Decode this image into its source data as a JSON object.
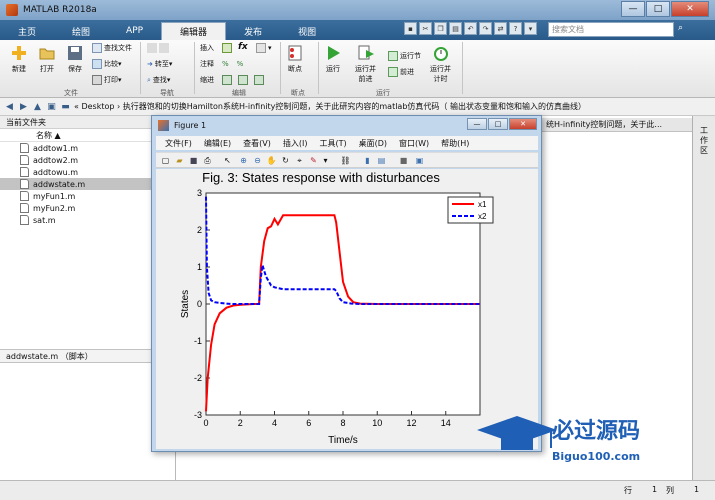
{
  "window": {
    "title": "MATLAB R2018a"
  },
  "tabs": [
    {
      "label": "主页"
    },
    {
      "label": "绘图"
    },
    {
      "label": "APP"
    },
    {
      "label": "编辑器"
    },
    {
      "label": "发布"
    },
    {
      "label": "视图"
    }
  ],
  "search": {
    "placeholder": "搜索文档"
  },
  "ribbon": {
    "file": {
      "new": "新建",
      "open": "打开",
      "save": "保存",
      "find_files": "查找文件",
      "compare": "比较",
      "print": "打印",
      "group": "文件"
    },
    "nav": {
      "goto": "转至",
      "find": "查找",
      "group": "导航"
    },
    "edit": {
      "insert": "插入",
      "comment": "注释",
      "indent": "缩进",
      "fx": "fx",
      "group": "编辑"
    },
    "breakpoints": {
      "label": "断点",
      "group": "断点"
    },
    "run": {
      "run": "运行",
      "run_advance": "运行并\n前进",
      "run_section": "运行节",
      "advance": "前进",
      "run_time": "运行并\n计时",
      "group": "运行"
    }
  },
  "address": {
    "path": "« Desktop › 执行器饱和的切换Hamilton系统H-infinity控制问题，关于此研究内容的matlab仿真代码（ 输出状态变量和饱和输入的仿真曲线）"
  },
  "current_folder": {
    "header": "当前文件夹",
    "col_name": "名称",
    "col_sort": "▲",
    "files": [
      "addtow1.m",
      "addtow2.m",
      "addtowu.m",
      "addwstate.m",
      "myFun1.m",
      "myFun2.m",
      "sat.m"
    ],
    "selected_index": 3,
    "detail": "addwstate.m （脚本）"
  },
  "editor": {
    "tab_text": "统H-infinity控制问题，关于此..."
  },
  "right_panel": {
    "label": "工作区"
  },
  "status": {
    "row_label": "行",
    "row_value": "1",
    "col_label": "列",
    "col_value": "1"
  },
  "figure": {
    "title": "Figure 1",
    "menu": [
      "文件(F)",
      "编辑(E)",
      "查看(V)",
      "插入(I)",
      "工具(T)",
      "桌面(D)",
      "窗口(W)",
      "帮助(H)"
    ]
  },
  "chart_data": {
    "type": "line",
    "title": "Fig. 3: States response with disturbances",
    "xlabel": "Time/s",
    "ylabel": "States",
    "xlim": [
      0,
      16
    ],
    "ylim": [
      -3,
      3
    ],
    "xticks": [
      0,
      2,
      4,
      6,
      8,
      10,
      12,
      14
    ],
    "yticks": [
      -3,
      -2,
      -1,
      0,
      1,
      2,
      3
    ],
    "legend_position": "top-right",
    "series": [
      {
        "name": "x1",
        "color": "#ff0000",
        "style": "solid",
        "x": [
          0,
          0.1,
          0.3,
          0.5,
          0.8,
          1.2,
          1.6,
          2.0,
          2.4,
          2.8,
          3.1,
          3.2,
          3.4,
          3.6,
          3.8,
          4.0,
          4.2,
          4.5,
          5,
          5.5,
          6,
          6.5,
          7,
          7.5,
          7.6,
          7.8,
          8.0,
          8.3,
          8.6,
          9.0,
          10,
          12,
          14,
          16
        ],
        "y": [
          -2.9,
          -2.0,
          -1.1,
          -0.55,
          -0.25,
          -0.1,
          -0.04,
          -0.02,
          -0.01,
          0,
          0,
          1.0,
          1.7,
          2.05,
          2.1,
          2.3,
          2.15,
          2.4,
          2.4,
          2.4,
          2.4,
          2.4,
          2.4,
          2.4,
          2.2,
          1.4,
          0.6,
          0.2,
          0.05,
          0.01,
          0,
          0,
          0,
          0
        ]
      },
      {
        "name": "x2",
        "color": "#0000ff",
        "style": "dashed",
        "x": [
          0,
          0.05,
          0.15,
          0.3,
          0.5,
          0.8,
          1.2,
          1.6,
          2.0,
          3.0,
          3.1,
          3.2,
          3.3,
          3.5,
          3.8,
          4.0,
          4.5,
          5,
          5.5,
          6,
          6.5,
          7,
          7.5,
          7.6,
          7.8,
          8.0,
          8.5,
          9,
          10,
          12,
          14,
          16
        ],
        "y": [
          2.9,
          1.0,
          0.3,
          0.1,
          0.05,
          0.03,
          0.01,
          0,
          0,
          0,
          0,
          0.7,
          1.05,
          0.75,
          0.5,
          0.45,
          0.4,
          0.4,
          0.4,
          0.4,
          0.4,
          0.4,
          0.4,
          0.35,
          0.15,
          0.05,
          0.01,
          0,
          0,
          0,
          0,
          0
        ]
      }
    ]
  },
  "watermark": {
    "text": "必过源码",
    "sub": "Biguo100.com"
  }
}
